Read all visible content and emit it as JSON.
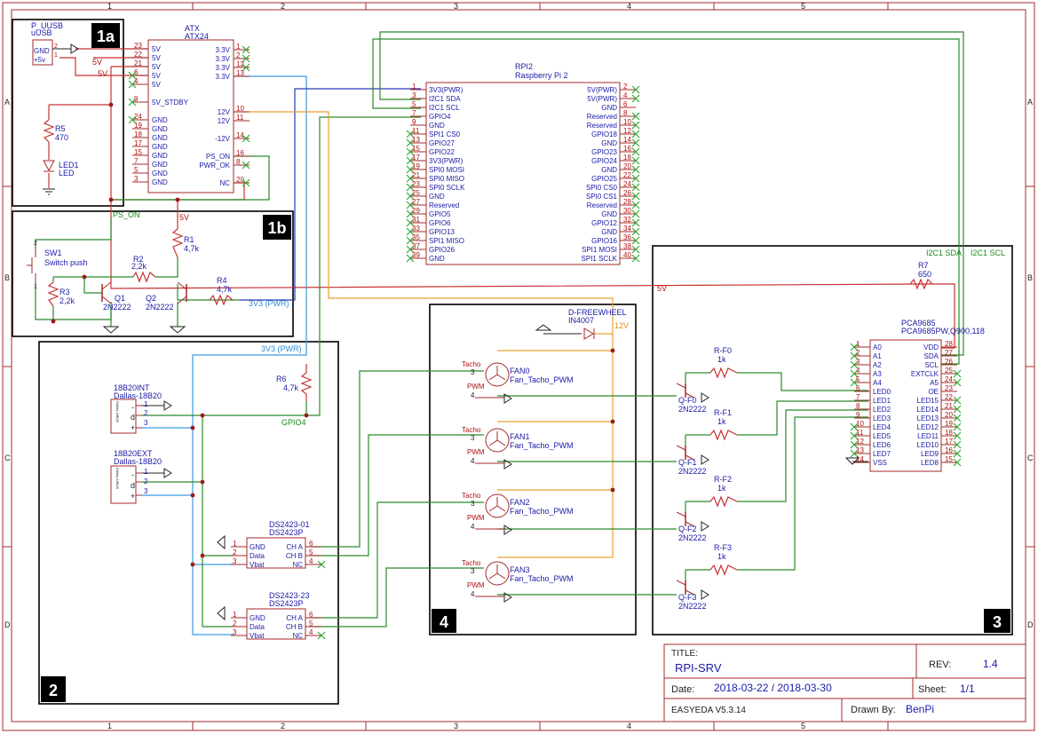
{
  "frame": {
    "col_labels": [
      "1",
      "2",
      "3",
      "4",
      "5"
    ],
    "row_labels": [
      "A",
      "B",
      "C",
      "D"
    ]
  },
  "blocks": {
    "b1a": "1a",
    "b1b": "1b",
    "b2": "2",
    "b3": "3",
    "b4": "4"
  },
  "power": {
    "uusb": {
      "ref": "P_UUSB",
      "value": "uUSB",
      "pins": [
        "GND",
        "+5v"
      ],
      "pin_nums": [
        "2",
        "1"
      ]
    },
    "atx": {
      "ref": "ATX",
      "value": "ATX24",
      "left_pins": [
        {
          "n": "23",
          "l": "5V"
        },
        {
          "n": "22",
          "l": "5V"
        },
        {
          "n": "21",
          "l": "5V"
        },
        {
          "n": "6",
          "l": "5V"
        },
        {
          "n": "4",
          "l": "5V"
        },
        {
          "n": "9",
          "l": "5V_STDBY"
        },
        {
          "n": "24",
          "l": "GND"
        },
        {
          "n": "19",
          "l": "GND"
        },
        {
          "n": "18",
          "l": "GND"
        },
        {
          "n": "17",
          "l": "GND"
        },
        {
          "n": "15",
          "l": "GND"
        },
        {
          "n": "7",
          "l": "GND"
        },
        {
          "n": "5",
          "l": "GND"
        },
        {
          "n": "3",
          "l": "GND"
        }
      ],
      "right_pins": [
        {
          "n": "1",
          "l": "3.3V"
        },
        {
          "n": "2",
          "l": "3.3V"
        },
        {
          "n": "12",
          "l": "3.3V"
        },
        {
          "n": "13",
          "l": "3.3V"
        },
        {
          "n": "10",
          "l": "12V"
        },
        {
          "n": "11",
          "l": "12V"
        },
        {
          "n": "14",
          "l": "-12V"
        },
        {
          "n": "16",
          "l": "PS_ON"
        },
        {
          "n": "8",
          "l": "PWR_OK"
        },
        {
          "n": "20",
          "l": "NC"
        }
      ]
    },
    "r5": {
      "ref": "R5",
      "value": "470"
    },
    "led1": {
      "ref": "LED1",
      "value": "LED"
    },
    "net_5v": "5V",
    "net_ps_on": "PS_ON",
    "sw1": {
      "ref": "SW1",
      "value": "Switch push",
      "pins": [
        "2",
        "1"
      ]
    },
    "r1": {
      "ref": "R1",
      "value": "4,7k"
    },
    "r2": {
      "ref": "R2",
      "value": "2,2k"
    },
    "r3": {
      "ref": "R3",
      "value": "2,2k"
    },
    "r4": {
      "ref": "R4",
      "value": "4,7k"
    },
    "q1": {
      "ref": "Q1",
      "value": "2N2222"
    },
    "q2": {
      "ref": "Q2",
      "value": "2N2222"
    },
    "net_3v3": "3V3 (PWR)"
  },
  "rpi": {
    "ref": "RPI2",
    "value": "Raspberry Pi 2",
    "left": [
      {
        "n": "1",
        "l": "3V3(PWR)"
      },
      {
        "n": "3",
        "l": "I2C1 SDA"
      },
      {
        "n": "5",
        "l": "I2C1 SCL"
      },
      {
        "n": "7",
        "l": "GPIO4"
      },
      {
        "n": "9",
        "l": "GND"
      },
      {
        "n": "11",
        "l": "SPI1 CS0"
      },
      {
        "n": "13",
        "l": "GPIO27"
      },
      {
        "n": "15",
        "l": "GPIO22"
      },
      {
        "n": "17",
        "l": "3V3(PWR)"
      },
      {
        "n": "19",
        "l": "SPI0 MOSI"
      },
      {
        "n": "21",
        "l": "SPI0 MISO"
      },
      {
        "n": "23",
        "l": "SPI0 SCLK"
      },
      {
        "n": "25",
        "l": "GND"
      },
      {
        "n": "27",
        "l": "Reserved"
      },
      {
        "n": "29",
        "l": "GPIO5"
      },
      {
        "n": "31",
        "l": "GPIO6"
      },
      {
        "n": "33",
        "l": "GPIO13"
      },
      {
        "n": "35",
        "l": "SPI1 MISO"
      },
      {
        "n": "37",
        "l": "GPIO26"
      },
      {
        "n": "39",
        "l": "GND"
      }
    ],
    "right": [
      {
        "n": "2",
        "l": "5V(PWR)"
      },
      {
        "n": "4",
        "l": "5V(PWR)"
      },
      {
        "n": "6",
        "l": "GND"
      },
      {
        "n": "8",
        "l": "Reserved"
      },
      {
        "n": "10",
        "l": "Reserved"
      },
      {
        "n": "12",
        "l": "GPIO18"
      },
      {
        "n": "14",
        "l": "GND"
      },
      {
        "n": "16",
        "l": "GPIO23"
      },
      {
        "n": "18",
        "l": "GPIO24"
      },
      {
        "n": "20",
        "l": "GND"
      },
      {
        "n": "22",
        "l": "GPIO25"
      },
      {
        "n": "24",
        "l": "SPI0 CS0"
      },
      {
        "n": "26",
        "l": "SPI0 CS1"
      },
      {
        "n": "28",
        "l": "Reserved"
      },
      {
        "n": "30",
        "l": "GND"
      },
      {
        "n": "32",
        "l": "GPIO12"
      },
      {
        "n": "34",
        "l": "GND"
      },
      {
        "n": "36",
        "l": "GPIO16"
      },
      {
        "n": "38",
        "l": "SPI1 MOSI"
      },
      {
        "n": "40",
        "l": "SPI1 SCLK"
      }
    ]
  },
  "sensors": {
    "net_3v3": "3V3 (PWR)",
    "r6": {
      "ref": "R6",
      "value": "4,7k"
    },
    "net_gpio4": "GPIO4",
    "int": {
      "ref": "18B20INT",
      "value": "Dallas-18B20",
      "pins": [
        "1",
        "2",
        "3"
      ],
      "sym": [
        "-",
        "d",
        "+"
      ],
      "side": "Dallas-18B20"
    },
    "ext": {
      "ref": "18B20EXT",
      "value": "Dallas-18B20",
      "pins": [
        "1",
        "2",
        "3"
      ],
      "sym": [
        "-",
        "d",
        "+"
      ],
      "side": "Dallas-18B20"
    },
    "ds1": {
      "ref": "DS2423-01",
      "value": "DS2423P",
      "left": [
        {
          "n": "1",
          "l": "GND"
        },
        {
          "n": "2",
          "l": "Data"
        },
        {
          "n": "3",
          "l": "Vbat"
        }
      ],
      "right": [
        {
          "n": "6",
          "l": "CH A"
        },
        {
          "n": "5",
          "l": "CH B"
        },
        {
          "n": "4",
          "l": "NC"
        }
      ]
    },
    "ds2": {
      "ref": "DS2423-23",
      "value": "DS2423P",
      "left": [
        {
          "n": "1",
          "l": "GND"
        },
        {
          "n": "2",
          "l": "Data"
        },
        {
          "n": "3",
          "l": "Vbat"
        }
      ],
      "right": [
        {
          "n": "6",
          "l": "CH A"
        },
        {
          "n": "5",
          "l": "CH B"
        },
        {
          "n": "4",
          "l": "NC"
        }
      ]
    }
  },
  "fans": {
    "diode": {
      "ref": "D-FREEWHEEL",
      "value": "IN4007"
    },
    "net_12v": "12V",
    "items": [
      {
        "ref": "FAN0",
        "value": "Fan_Tacho_PWM"
      },
      {
        "ref": "FAN1",
        "value": "Fan_Tacho_PWM"
      },
      {
        "ref": "FAN2",
        "value": "Fan_Tacho_PWM"
      },
      {
        "ref": "FAN3",
        "value": "Fan_Tacho_PWM"
      }
    ],
    "tacho": "Tacho",
    "pwm": "PWM",
    "pins": [
      "3",
      "4"
    ]
  },
  "pwmdrv": {
    "net_sda": "I2C1 SDA",
    "net_scl": "I2C1 SCL",
    "r7": {
      "ref": "R7",
      "value": "650"
    },
    "net_5v": "5V",
    "pca": {
      "ref": "PCA9685",
      "value": "PCA9685PW,Q900,118",
      "left": [
        {
          "n": "1",
          "l": "A0"
        },
        {
          "n": "2",
          "l": "A1"
        },
        {
          "n": "3",
          "l": "A2"
        },
        {
          "n": "4",
          "l": "A3"
        },
        {
          "n": "5",
          "l": "A4"
        },
        {
          "n": "6",
          "l": "LED0"
        },
        {
          "n": "7",
          "l": "LED1"
        },
        {
          "n": "8",
          "l": "LED2"
        },
        {
          "n": "9",
          "l": "LED3"
        },
        {
          "n": "10",
          "l": "LED4"
        },
        {
          "n": "11",
          "l": "LED5"
        },
        {
          "n": "12",
          "l": "LED6"
        },
        {
          "n": "13",
          "l": "LED7"
        },
        {
          "n": "14",
          "l": "VSS"
        }
      ],
      "right": [
        {
          "n": "28",
          "l": "VDD"
        },
        {
          "n": "27",
          "l": "SDA"
        },
        {
          "n": "26",
          "l": "SCL"
        },
        {
          "n": "25",
          "l": "EXTCLK"
        },
        {
          "n": "24",
          "l": "A5"
        },
        {
          "n": "23",
          "l": "OE"
        },
        {
          "n": "22",
          "l": "LED15"
        },
        {
          "n": "21",
          "l": "LED14"
        },
        {
          "n": "20",
          "l": "LED13"
        },
        {
          "n": "19",
          "l": "LED12"
        },
        {
          "n": "18",
          "l": "LED11"
        },
        {
          "n": "17",
          "l": "LED10"
        },
        {
          "n": "16",
          "l": "LED9"
        },
        {
          "n": "15",
          "l": "LED8"
        }
      ]
    },
    "channels": [
      {
        "r": "R-F0",
        "rv": "1k",
        "q": "Q-F0",
        "qv": "2N2222"
      },
      {
        "r": "R-F1",
        "rv": "1k",
        "q": "Q-F1",
        "qv": "2N2222"
      },
      {
        "r": "R-F2",
        "rv": "1k",
        "q": "Q-F2",
        "qv": "2N2222"
      },
      {
        "r": "R-F3",
        "rv": "1k",
        "q": "Q-F3",
        "qv": "2N2222"
      }
    ]
  },
  "titleblock": {
    "title_label": "TITLE:",
    "title": "RPI-SRV",
    "rev_label": "REV:",
    "rev": "1.4",
    "date_label": "Date:",
    "date": "2018-03-22 / 2018-03-30",
    "sheet_label": "Sheet:",
    "sheet": "1/1",
    "tool": "EASYEDA V5.3.14",
    "drawn_label": "Drawn By:",
    "drawn": "BenPi"
  }
}
